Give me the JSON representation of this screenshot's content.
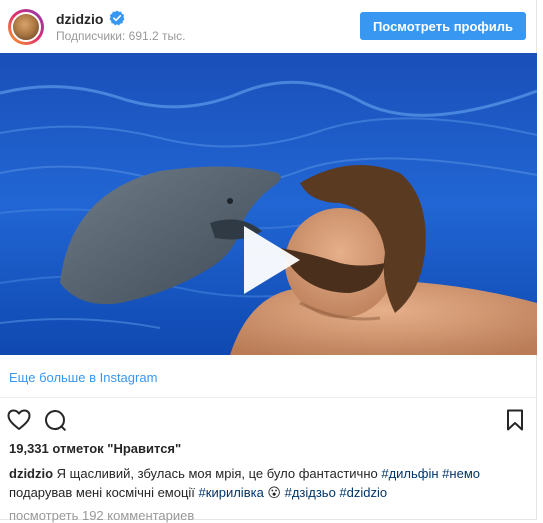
{
  "header": {
    "username": "dzidzio",
    "followers": "Подписчики: 691.2 тыс.",
    "view_profile_label": "Посмотреть профиль",
    "verified_icon": "verified-badge-icon",
    "accent_color": "#3897f0"
  },
  "media": {
    "type": "video",
    "play_icon": "play-icon"
  },
  "more_link": "Еще больше в Instagram",
  "actions": {
    "like_icon": "heart-icon",
    "comment_icon": "comment-icon",
    "save_icon": "bookmark-icon"
  },
  "likes_text": "19,331 отметок \"Нравится\"",
  "caption": {
    "username": "dzidzio",
    "text_part1": " Я щасливий, збулась моя мрія, це було фантастично ",
    "tag1": "#дильфін",
    "tag2": " #немо",
    "text_part2": " подарував мені космічні емоції ",
    "tag3": "#кирилівка",
    "emoji": " 😮 ",
    "tag4": "#дзідзьо",
    "tag5": " #dzidzio"
  },
  "comments_link": "посмотреть 192 комментариев"
}
